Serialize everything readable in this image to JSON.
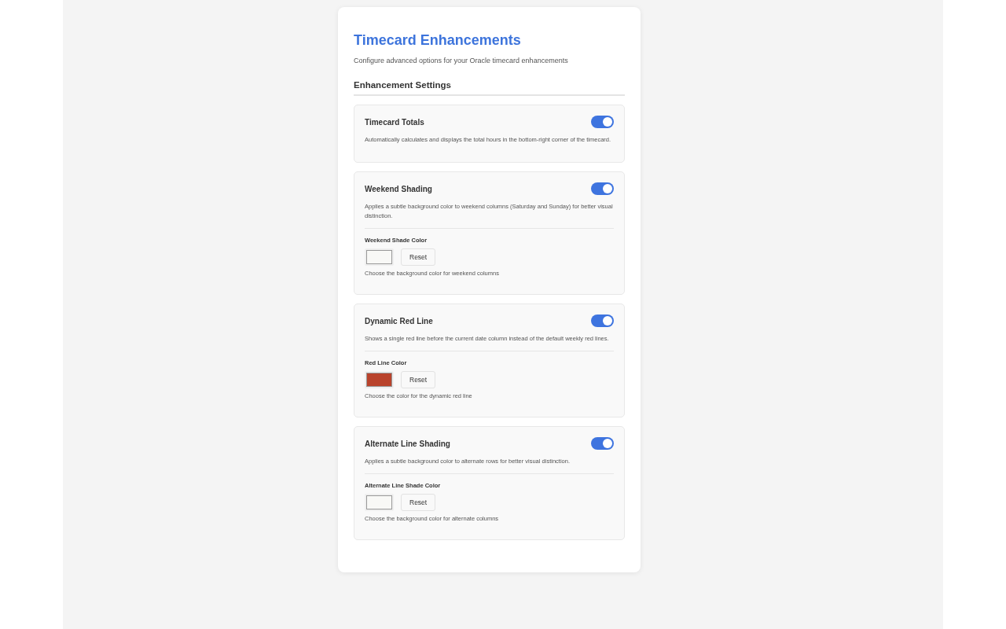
{
  "title": "Timecard Enhancements",
  "subtitle": "Configure advanced options for your Oracle timecard enhancements",
  "section_title": "Enhancement Settings",
  "settings": [
    {
      "title": "Timecard Totals",
      "on": true,
      "description": "Automatically calculates and displays the total hours in the bottom-right corner of the timecard."
    },
    {
      "title": "Weekend Shading",
      "on": true,
      "description": "Applies a subtle background color to weekend columns (Saturday and Sunday) for better visual distinction.",
      "color_option": {
        "label": "Weekend Shade Color",
        "color": "#f8f8f6",
        "button": "Reset",
        "hint": "Choose the background color for weekend columns"
      }
    },
    {
      "title": "Dynamic Red Line",
      "on": true,
      "description": "Shows a single red line before the current date column instead of the default weekly red lines.",
      "color_option": {
        "label": "Red Line Color",
        "color": "#b9432c",
        "button": "Reset",
        "hint": "Choose the color for the dynamic red line"
      }
    },
    {
      "title": "Alternate Line Shading",
      "on": true,
      "description": "Applies a subtle background color to alternate rows for better visual distinction.",
      "color_option": {
        "label": "Alternate Line Shade Color",
        "color": "#f8f8f6",
        "button": "Reset",
        "hint": "Choose the background color for alternate columns"
      }
    }
  ]
}
